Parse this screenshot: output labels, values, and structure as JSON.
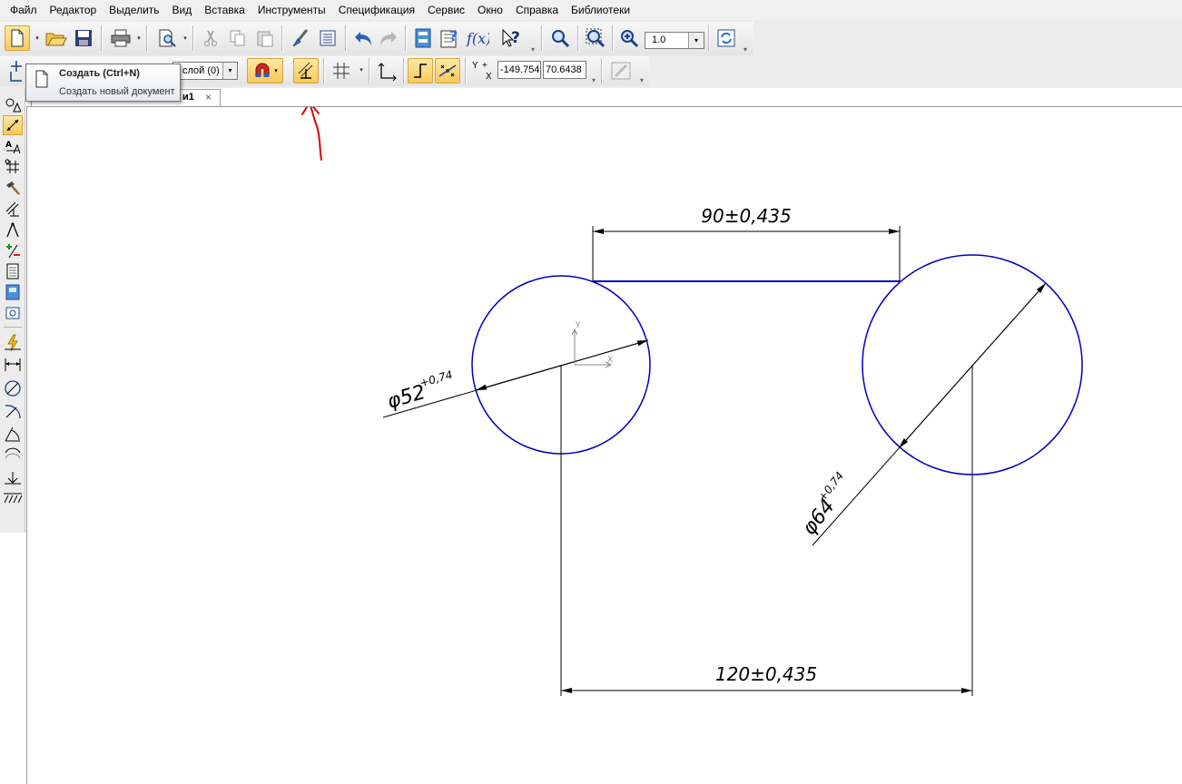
{
  "menu": {
    "items": [
      "Файл",
      "Редактор",
      "Выделить",
      "Вид",
      "Вставка",
      "Инструменты",
      "Спецификация",
      "Сервис",
      "Окно",
      "Справка",
      "Библиотеки"
    ]
  },
  "toolbar": {
    "zoom_value": "1.0",
    "layer_value": "слой (0)",
    "coord_y_label": "Y",
    "coord_x_label": "X",
    "coord_x_value": "-149.754",
    "coord_y_value": "70.6438"
  },
  "tooltip": {
    "title": "Создать (Ctrl+N)",
    "description": "Создать новый документ"
  },
  "document_tab": {
    "label": "и1",
    "close": "×"
  },
  "drawing": {
    "dimensions": {
      "top_width": "90±0,435",
      "bottom_width": "120±0,435",
      "left_diameter_symbol": "φ52",
      "left_diameter_tolerance": "+0,74",
      "right_diameter_symbol": "φ64",
      "right_diameter_tolerance": "+0,74"
    },
    "axis_labels": {
      "x": "X",
      "y": "Y"
    },
    "colors": {
      "geometry": "#0000c0",
      "dimension": "#000000",
      "annotation_arrow": "#e00000"
    }
  },
  "colors": {
    "active_button": "#f6c95a",
    "toolbar_bg": "#ececec"
  }
}
